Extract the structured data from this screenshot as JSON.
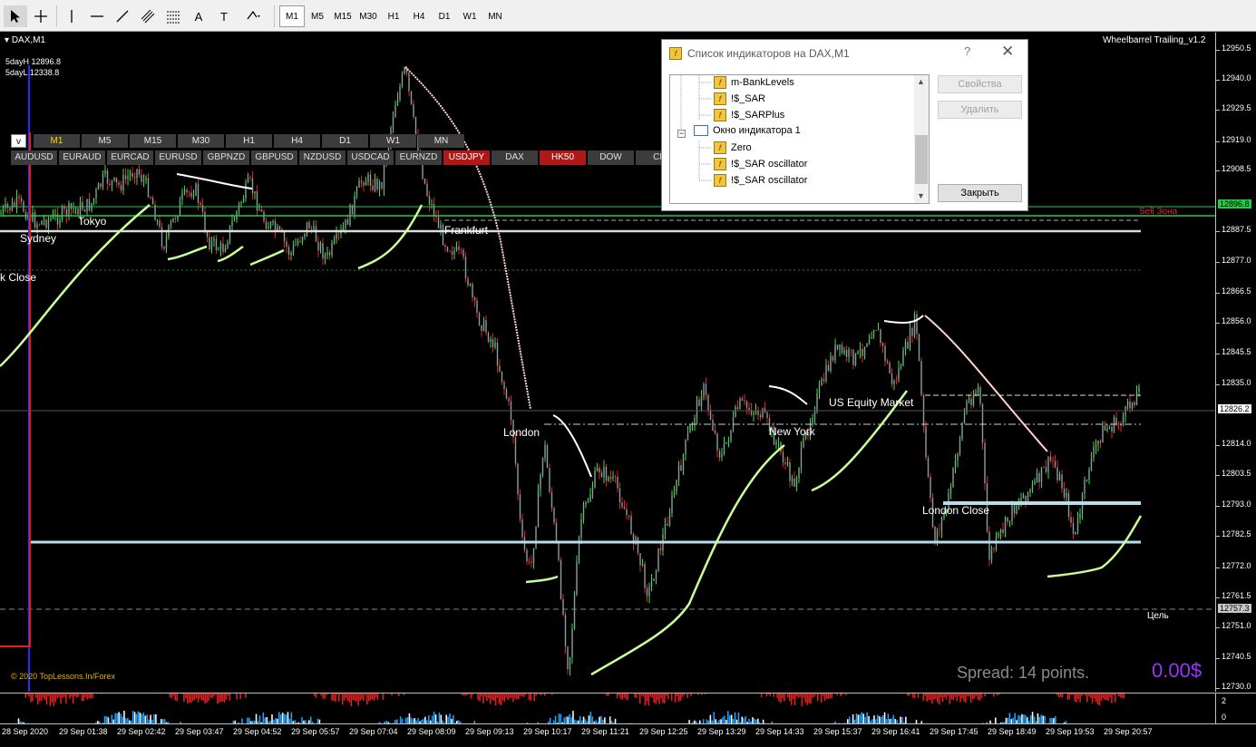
{
  "toolbar": {
    "tools": [
      {
        "name": "cursor-icon"
      },
      {
        "name": "crosshair-icon"
      },
      {
        "name": "vertical-line-icon"
      },
      {
        "name": "horizontal-line-icon"
      },
      {
        "name": "trendline-icon"
      },
      {
        "name": "channel-icon"
      },
      {
        "name": "fibonacci-icon"
      },
      {
        "name": "text-icon",
        "label": "A"
      },
      {
        "name": "text-label-icon",
        "label": "T"
      },
      {
        "name": "shapes-icon"
      }
    ],
    "timeframes": [
      "M1",
      "M5",
      "M15",
      "M30",
      "H1",
      "H4",
      "D1",
      "W1",
      "MN"
    ],
    "active_timeframe": "M1"
  },
  "chart": {
    "symbol": "DAX,M1",
    "indicator_name": "Wheelbarrel Trailing_v1.2",
    "five_day_high": "5dayH 12896.8",
    "five_day_low": "5dayL 12338.8",
    "copyright": "© 2020 TopLessons.In/Forex",
    "spread": "Spread: 14 points.",
    "profit": "0.00$",
    "target_label": "Цель",
    "sell_zone_label": "Sell Зона",
    "sessions": [
      "Sydney",
      "Tokyo",
      "k Close",
      "Frankfurt",
      "London",
      "New York",
      "US Equity Market",
      "London Close"
    ],
    "tf_strip": [
      "M1",
      "M5",
      "M15",
      "M30",
      "H1",
      "H4",
      "D1",
      "W1",
      "MN"
    ],
    "tf_strip_toggle": "v",
    "symbols": [
      "AUDUSD",
      "EURAUD",
      "EURCAD",
      "EURUSD",
      "GBPNZD",
      "GBPUSD",
      "NZDUSD",
      "USDCAD",
      "EURNZD",
      "USDJPY",
      "DAX",
      "HK50",
      "DOW",
      "CL"
    ],
    "highlight_symbols": [
      "USDJPY",
      "HK50"
    ]
  },
  "price_axis": {
    "labels": [
      "12950.5",
      "12940.0",
      "12929.5",
      "12919.0",
      "12908.5",
      "12887.5",
      "12877.0",
      "12866.5",
      "12856.0",
      "12845.5",
      "12835.0",
      "12814.0",
      "12803.5",
      "12793.0",
      "12782.5",
      "12772.0",
      "12761.5",
      "12751.0",
      "12740.5",
      "12730.0"
    ],
    "current_price": "12826.2",
    "sell_level": "12896.8",
    "target_level": "12757.3"
  },
  "sub_axis": {
    "labels": [
      "2",
      "0"
    ]
  },
  "time_axis": {
    "labels": [
      "28 Sep 2020",
      "29 Sep 01:38",
      "29 Sep 02:42",
      "29 Sep 03:47",
      "29 Sep 04:52",
      "29 Sep 05:57",
      "29 Sep 07:04",
      "29 Sep 08:09",
      "29 Sep 09:13",
      "29 Sep 10:17",
      "29 Sep 11:21",
      "29 Sep 12:25",
      "29 Sep 13:29",
      "29 Sep 14:33",
      "29 Sep 15:37",
      "29 Sep 16:41",
      "29 Sep 17:45",
      "29 Sep 18:49",
      "29 Sep 19:53",
      "29 Sep 20:57"
    ]
  },
  "dialog": {
    "title": "Список индикаторов на DAX,M1",
    "help": "?",
    "close": "✕",
    "items": [
      {
        "label": "m-BankLevels",
        "type": "indicator",
        "indent": 1
      },
      {
        "label": "!$_SAR",
        "type": "indicator",
        "indent": 1
      },
      {
        "label": "!$_SARPlus",
        "type": "indicator",
        "indent": 1
      },
      {
        "label": "Окно индикатора 1",
        "type": "window",
        "indent": 0
      },
      {
        "label": "Zero",
        "type": "indicator",
        "indent": 1
      },
      {
        "label": "!$_SAR oscillator",
        "type": "indicator",
        "indent": 1
      },
      {
        "label": "!$_SAR oscillator",
        "type": "indicator",
        "indent": 1
      }
    ],
    "buttons": {
      "properties": "Свойства",
      "delete": "Удалить",
      "close": "Закрыть"
    }
  },
  "colors": {
    "bull": "#32e632",
    "bear": "#e62020",
    "body": "#8aa0a0",
    "sar_up": "#c8ff96",
    "sar_down": "#ffffff",
    "sar_dot": "#ffd0d0",
    "level": "#b8dcec",
    "sell_zone": "#22cc44",
    "accent_profit": "#9933ff"
  }
}
